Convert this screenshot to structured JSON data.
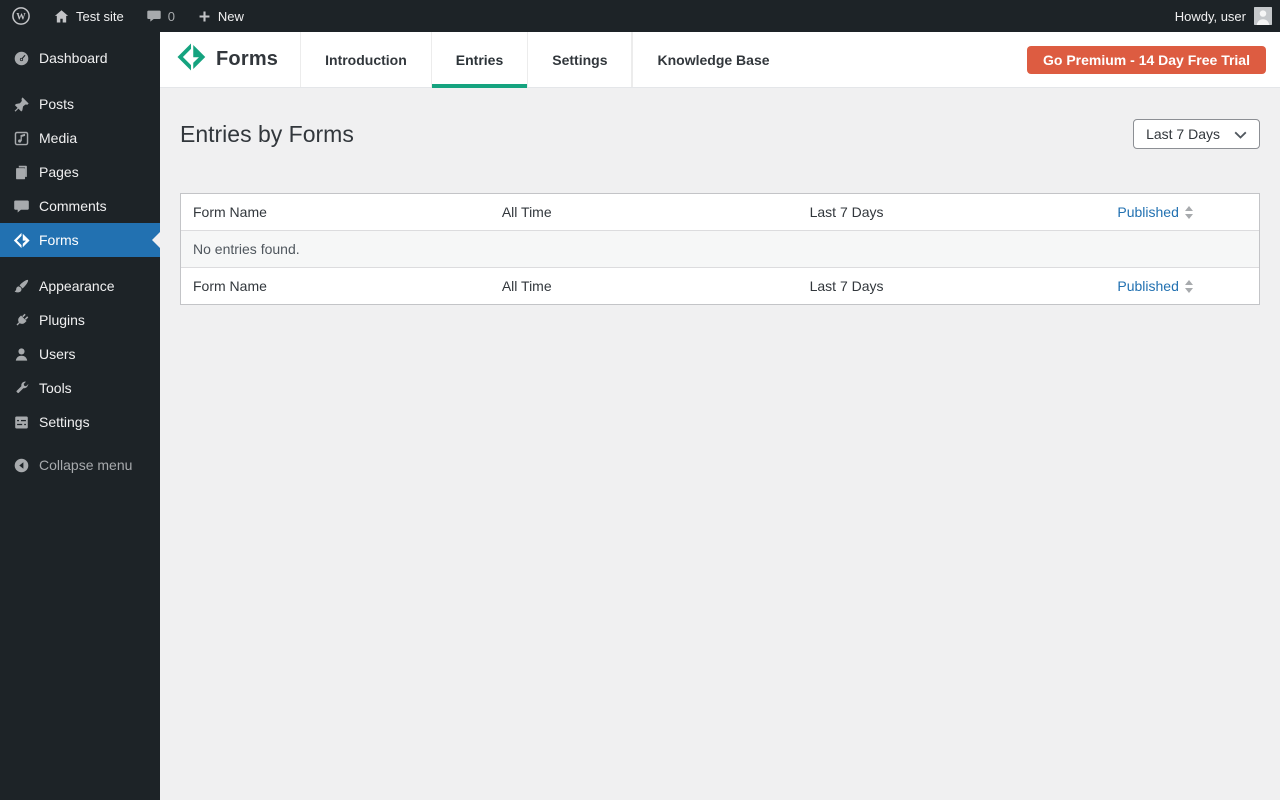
{
  "admin_bar": {
    "site_name": "Test site",
    "comment_count": "0",
    "new_label": "New",
    "howdy": "Howdy, user"
  },
  "sidebar": {
    "items": [
      {
        "label": "Dashboard",
        "icon": "dashboard-icon"
      },
      {
        "label": "Posts",
        "icon": "pushpin-icon"
      },
      {
        "label": "Media",
        "icon": "media-icon"
      },
      {
        "label": "Pages",
        "icon": "pages-icon"
      },
      {
        "label": "Comments",
        "icon": "comment-icon"
      },
      {
        "label": "Forms",
        "icon": "forms-diamond-icon",
        "active": true
      },
      {
        "label": "Appearance",
        "icon": "brush-icon"
      },
      {
        "label": "Plugins",
        "icon": "plug-icon"
      },
      {
        "label": "Users",
        "icon": "user-icon"
      },
      {
        "label": "Tools",
        "icon": "wrench-icon"
      },
      {
        "label": "Settings",
        "icon": "sliders-icon"
      }
    ],
    "collapse_label": "Collapse menu"
  },
  "plugin_header": {
    "brand": "Forms",
    "tabs": [
      {
        "label": "Introduction"
      },
      {
        "label": "Entries",
        "active": true
      },
      {
        "label": "Settings"
      },
      {
        "label": "Knowledge Base"
      }
    ],
    "premium_button": "Go Premium - 14 Day Free Trial"
  },
  "page": {
    "title": "Entries by Forms",
    "range_select": {
      "value": "Last 7 Days"
    },
    "table": {
      "columns": [
        "Form Name",
        "All Time",
        "Last 7 Days",
        "Published"
      ],
      "empty_message": "No entries found."
    }
  },
  "colors": {
    "accent_green": "#15a37f",
    "premium_orange": "#dd5c41",
    "link_blue": "#2271b1",
    "active_menu_blue": "#2271b1",
    "admin_dark": "#1d2327",
    "content_bg": "#f0f0f1"
  }
}
